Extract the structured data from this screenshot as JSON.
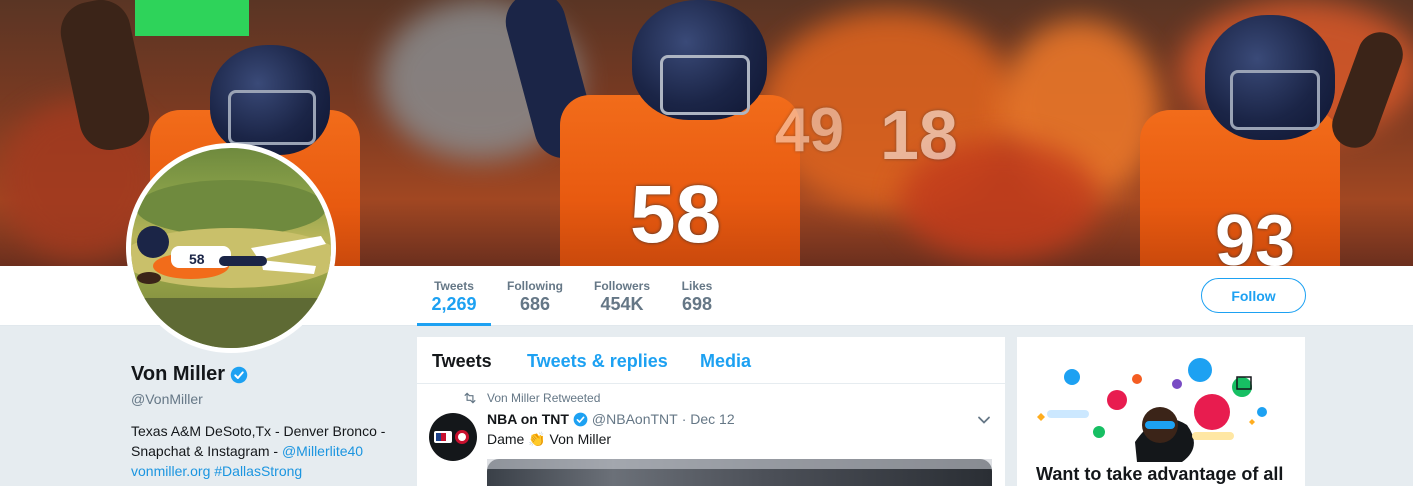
{
  "profile": {
    "name": "Von Miller",
    "handle": "@VonMiller",
    "bio_line1": "Texas A&M DeSoto,Tx - Denver Bronco -",
    "bio_line2_text": "Snapchat & Instagram - ",
    "bio_line2_link": "@Millerlite40",
    "bio_line3_site": "vonmiller.org",
    "bio_line3_hashtag": "#DallasStrong"
  },
  "banner": {
    "jersey_numbers": [
      "58",
      "93",
      "18",
      "49"
    ]
  },
  "stats": [
    {
      "label": "Tweets",
      "value": "2,269",
      "active": true
    },
    {
      "label": "Following",
      "value": "686"
    },
    {
      "label": "Followers",
      "value": "454K"
    },
    {
      "label": "Likes",
      "value": "698"
    }
  ],
  "follow_label": "Follow",
  "timeline": {
    "tabs": [
      "Tweets",
      "Tweets & replies",
      "Media"
    ],
    "retweet_label": "Von Miller Retweeted",
    "tweet": {
      "avatar_text": "NBA TNT",
      "author": "NBA on TNT",
      "handle": "@NBAonTNT",
      "date": "· Dec 12",
      "text_before": "Dame ",
      "text_after": " Von Miller",
      "emoji": "👏"
    }
  },
  "promo": {
    "title": "Want to take advantage of all"
  },
  "colors": {
    "accent": "#1da1f2",
    "link": "#1b95e0",
    "bronco_orange": "#f26c1a",
    "bronco_navy": "#1b2547"
  }
}
